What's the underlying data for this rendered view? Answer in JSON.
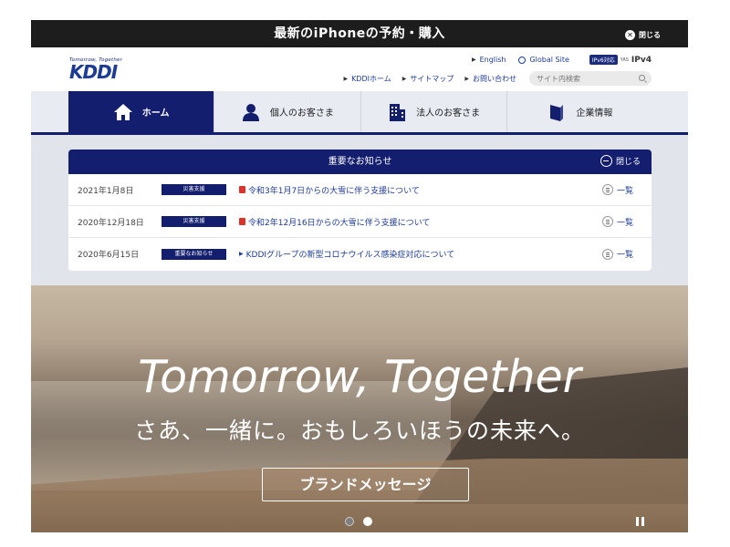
{
  "promo": {
    "title": "最新のiPhoneの予約・購入",
    "close_label": "閉じる"
  },
  "header": {
    "logo_tagline": "Tomorrow, Together",
    "logo_text": "KDDI",
    "links_top": [
      "English",
      "Global Site"
    ],
    "ipv6": {
      "badge": "IPv6対応",
      "small": "YAS",
      "v4": "IPv4"
    },
    "links_bottom": [
      "KDDIホーム",
      "サイトマップ",
      "お問い合わせ"
    ],
    "search_placeholder": "サイト内検索"
  },
  "nav": {
    "items": [
      {
        "label": "ホーム",
        "icon": "home-icon"
      },
      {
        "label": "個人のお客さま",
        "icon": "person-icon"
      },
      {
        "label": "法人のお客さま",
        "icon": "building-icon"
      },
      {
        "label": "企業情報",
        "icon": "book-icon"
      }
    ]
  },
  "notices": {
    "title": "重要なお知らせ",
    "close_label": "閉じる",
    "list_label": "一覧",
    "rows": [
      {
        "date": "2021年1月8日",
        "badge": "災害支援",
        "text": "令和3年1月7日からの大雪に伴う支援について",
        "icon": "pdf-icon"
      },
      {
        "date": "2020年12月18日",
        "badge": "災害支援",
        "text": "令和2年12月16日からの大雪に伴う支援について",
        "icon": "pdf-icon"
      },
      {
        "date": "2020年6月15日",
        "badge": "重要なお知らせ",
        "text": "KDDIグループの新型コロナウイルス感染症対応について",
        "icon": "arrow-icon"
      }
    ]
  },
  "hero": {
    "title": "Tomorrow, Together",
    "subtitle": "さあ、一緒に。おもしろいほうの未来へ。",
    "button_label": "ブランドメッセージ"
  },
  "colors": {
    "navy": "#141e6e",
    "link": "#1c3b95",
    "promo_bg": "#1d1d1d"
  }
}
